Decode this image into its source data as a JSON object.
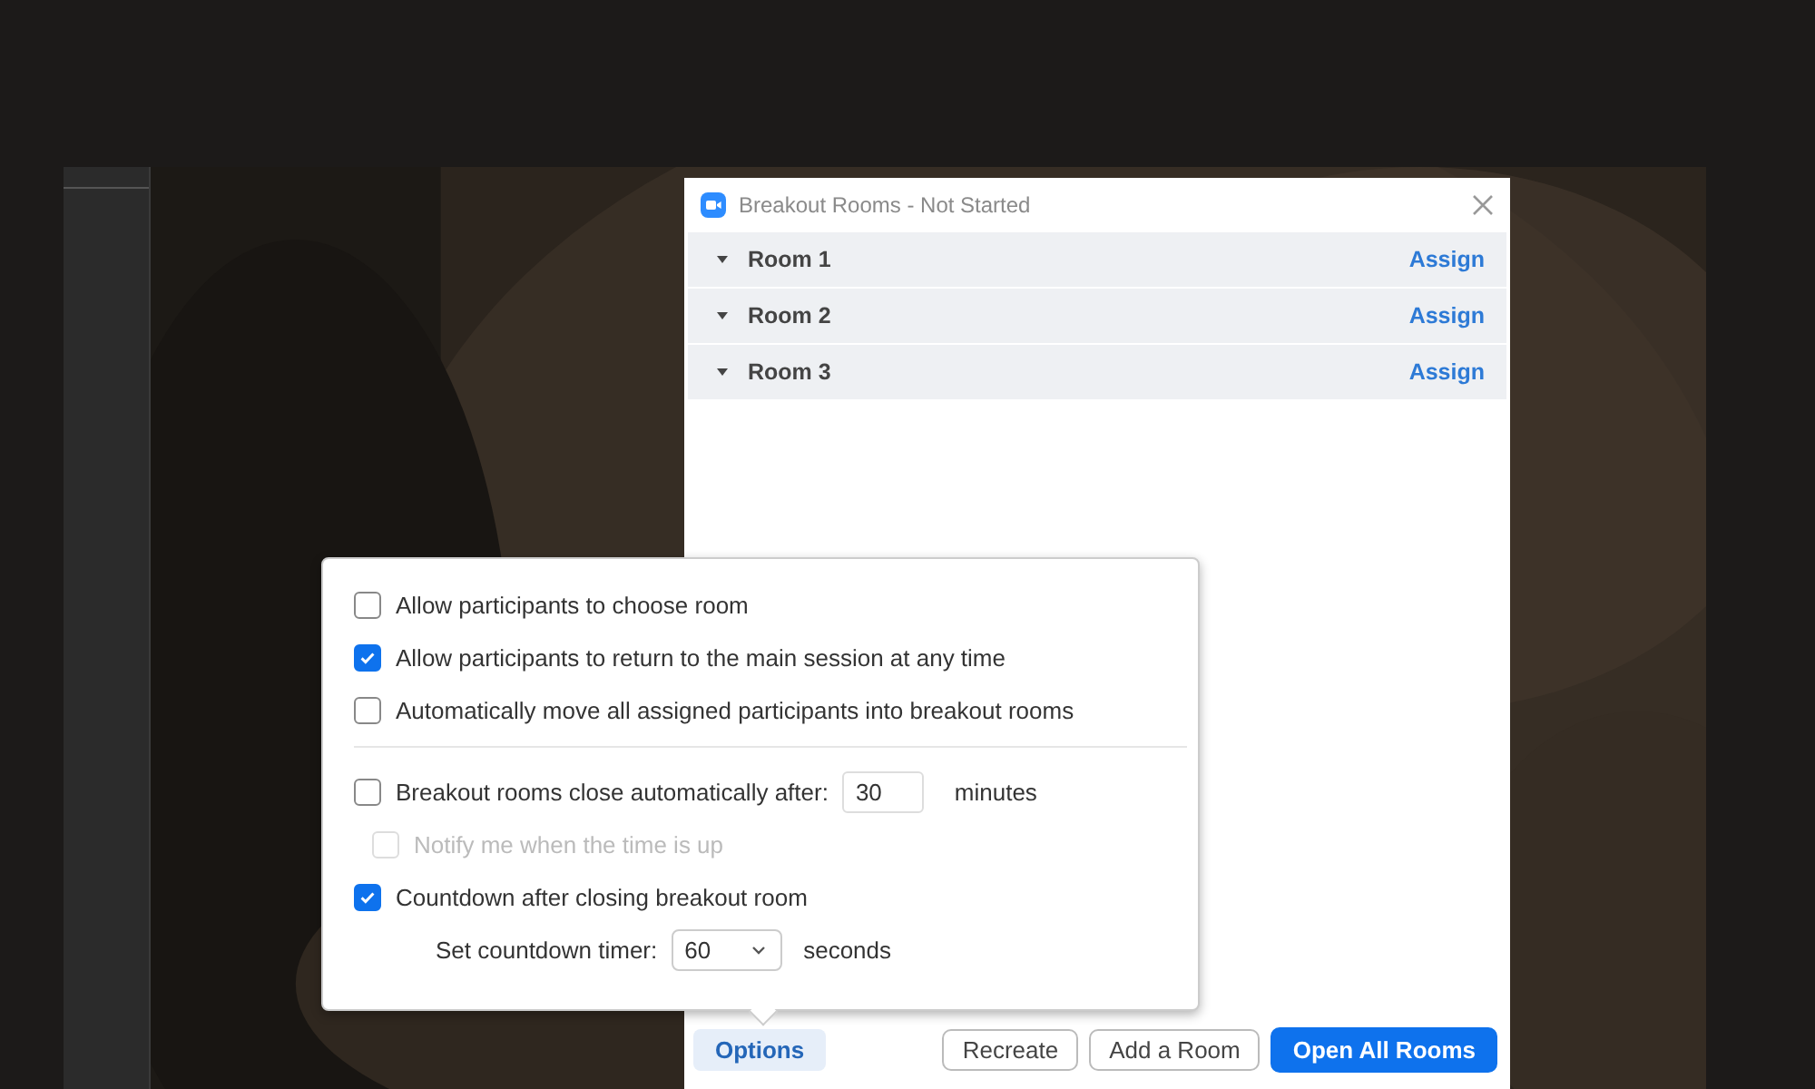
{
  "window": {
    "title": "Breakout Rooms - Not Started"
  },
  "rooms": [
    {
      "name": "Room 1",
      "action": "Assign"
    },
    {
      "name": "Room 2",
      "action": "Assign"
    },
    {
      "name": "Room 3",
      "action": "Assign"
    }
  ],
  "options_popup": {
    "groups": [
      [
        {
          "kind": "checkbox",
          "label": "Allow participants to choose room",
          "checked": false,
          "disabled": false
        },
        {
          "kind": "checkbox",
          "label": "Allow participants to return to the main session at any time",
          "checked": true,
          "disabled": false
        },
        {
          "kind": "checkbox",
          "label": "Automatically move all assigned participants into breakout rooms",
          "checked": false,
          "disabled": false
        }
      ],
      [
        {
          "kind": "checkbox_field",
          "label": "Breakout rooms close automatically after:",
          "checked": false,
          "disabled": false,
          "value": "30",
          "suffix": "minutes",
          "children": [
            {
              "kind": "checkbox",
              "label": "Notify me when the time is up",
              "checked": false,
              "disabled": true
            }
          ]
        },
        {
          "kind": "checkbox",
          "label": "Countdown after closing breakout room",
          "checked": true,
          "disabled": false,
          "children": [
            {
              "kind": "select",
              "label": "Set countdown timer:",
              "value": "60",
              "suffix": "seconds"
            }
          ]
        }
      ]
    ]
  },
  "options_button": {
    "label": "Options",
    "selected": true
  },
  "buttons": [
    {
      "label": "Recreate",
      "kind": "secondary"
    },
    {
      "label": "Add a Room",
      "kind": "secondary"
    },
    {
      "label": "Open All Rooms",
      "kind": "primary"
    }
  ]
}
